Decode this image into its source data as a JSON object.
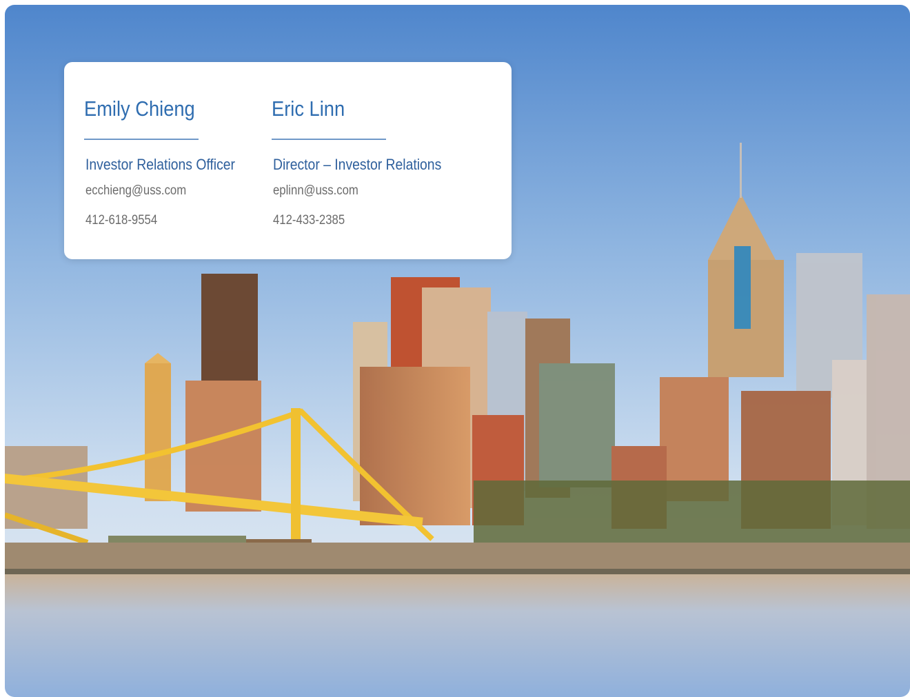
{
  "contacts": [
    {
      "name": "Emily Chieng",
      "title": "Investor Relations Officer",
      "email": "ecchieng@uss.com",
      "phone": "412-618-9554"
    },
    {
      "name": "Eric Linn",
      "title": "Director – Investor Relations",
      "email": "eplinn@uss.com",
      "phone": "412-433-2385"
    }
  ],
  "colors": {
    "name": "#2f6db0",
    "title": "#2e5f9c",
    "rule": "#6f98c8",
    "detail": "#6b6b6b",
    "bridge": "#f2c230"
  }
}
